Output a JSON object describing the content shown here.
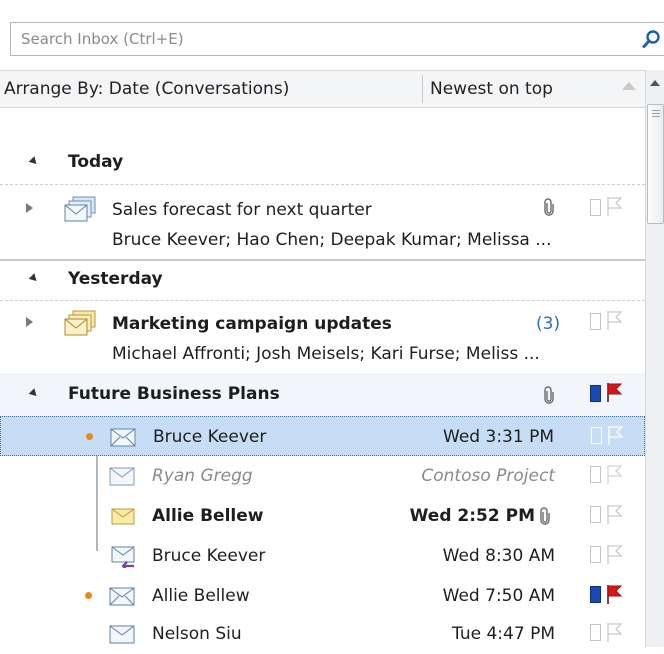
{
  "search": {
    "placeholder": "Search Inbox (Ctrl+E)",
    "icon": "search-icon"
  },
  "arrange": {
    "label": "Arrange By: Date (Conversations)",
    "order": "Newest on top"
  },
  "groups": [
    {
      "title": "Today",
      "conversations": [
        {
          "subject": "Sales forecast for next quarter",
          "people": "Bruce Keever; Hao Chen; Deepak Kumar; Melissa ...",
          "has_attachment": true,
          "flagged": false
        }
      ]
    },
    {
      "title": "Yesterday",
      "conversations": [
        {
          "subject": "Marketing campaign updates",
          "people": "Michael Affronti; Josh Meisels; Kari Furse; Meliss ...",
          "unread_count": "(3)",
          "flagged": false
        }
      ]
    },
    {
      "title": "Future Business Plans",
      "has_attachment": true,
      "category_color": "#1a49b6",
      "flagged": true,
      "messages": [
        {
          "sender": "Bruce Keever",
          "time": "Wed 3:31 PM",
          "selected": true
        },
        {
          "sender": "Ryan Gregg",
          "time": "Contoso Project",
          "style": "italic"
        },
        {
          "sender": "Allie Bellew",
          "time": "Wed 2:52 PM",
          "style": "bold",
          "has_attachment": true
        },
        {
          "sender": "Bruce Keever",
          "time": "Wed 8:30 AM"
        },
        {
          "sender": "Allie Bellew",
          "time": "Wed 7:50 AM",
          "flagged": true
        },
        {
          "sender": "Nelson Siu",
          "time": "Tue 4:47 PM"
        }
      ]
    }
  ],
  "colors": {
    "accent_flag": "#d21a1a",
    "category_blue": "#1a49b6",
    "selection": "#c7ddf5",
    "thread_dot": "#e88a18",
    "link_count": "#2e6bc7"
  }
}
